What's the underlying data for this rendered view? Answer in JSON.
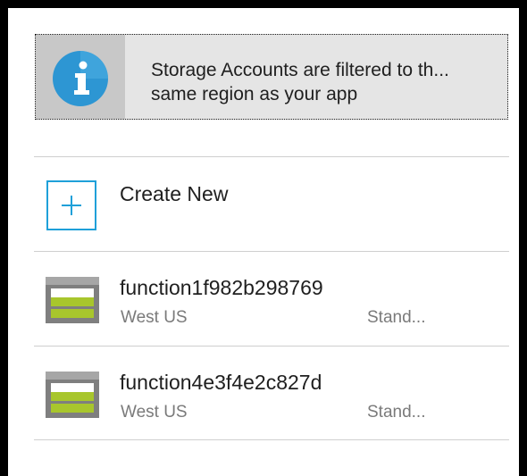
{
  "info": {
    "icon": "info-icon",
    "message": "Storage Accounts are filtered to th... same region as your app"
  },
  "create_new": {
    "icon": "plus-icon",
    "label": "Create New"
  },
  "accounts": [
    {
      "icon": "storage-account-icon",
      "name": "function1f982b298769",
      "region": "West US",
      "tier": "Stand..."
    },
    {
      "icon": "storage-account-icon",
      "name": "function4e3f4e2c827d",
      "region": "West US",
      "tier": "Stand..."
    }
  ],
  "colors": {
    "accent": "#1fa0d9",
    "info_icon_blue": "#2d96d3",
    "storage_green": "#a8c62c",
    "storage_gray": "#7f7f7f"
  }
}
